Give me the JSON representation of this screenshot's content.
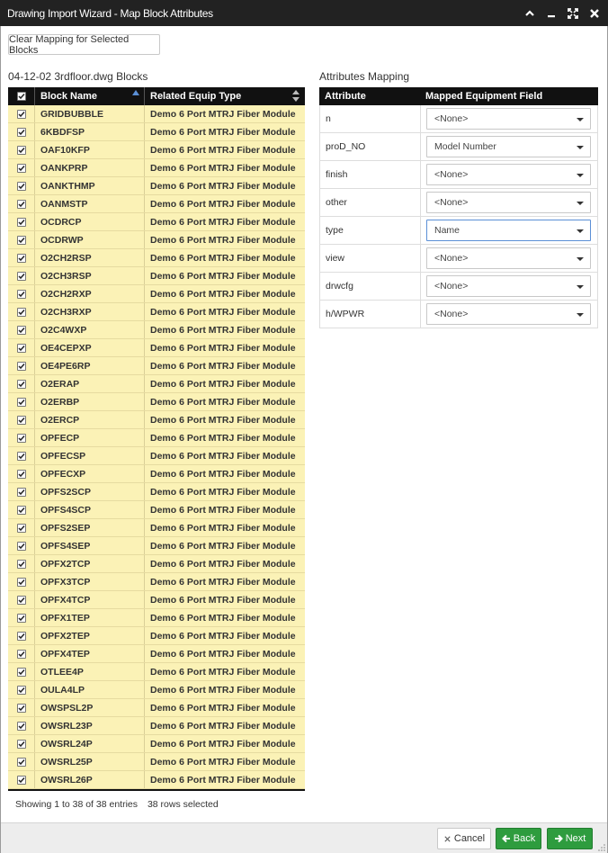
{
  "window": {
    "title": "Drawing Import Wizard - Map Block Attributes"
  },
  "toolbar": {
    "clear_label": "Clear Mapping for Selected Blocks"
  },
  "blocks": {
    "title": "04-12-02 3rdfloor.dwg Blocks",
    "headers": {
      "name": "Block Name",
      "type": "Related Equip Type"
    },
    "rows": [
      {
        "name": "GRIDBUBBLE",
        "type": "Demo 6 Port MTRJ Fiber Module",
        "checked": true
      },
      {
        "name": "6KBDFSP",
        "type": "Demo 6 Port MTRJ Fiber Module",
        "checked": true
      },
      {
        "name": "OAF10KFP",
        "type": "Demo 6 Port MTRJ Fiber Module",
        "checked": true
      },
      {
        "name": "OANKPRP",
        "type": "Demo 6 Port MTRJ Fiber Module",
        "checked": true
      },
      {
        "name": "OANKTHMP",
        "type": "Demo 6 Port MTRJ Fiber Module",
        "checked": true
      },
      {
        "name": "OANMSTP",
        "type": "Demo 6 Port MTRJ Fiber Module",
        "checked": true
      },
      {
        "name": "OCDRCP",
        "type": "Demo 6 Port MTRJ Fiber Module",
        "checked": true
      },
      {
        "name": "OCDRWP",
        "type": "Demo 6 Port MTRJ Fiber Module",
        "checked": true
      },
      {
        "name": "O2CH2RSP",
        "type": "Demo 6 Port MTRJ Fiber Module",
        "checked": true
      },
      {
        "name": "O2CH3RSP",
        "type": "Demo 6 Port MTRJ Fiber Module",
        "checked": true
      },
      {
        "name": "O2CH2RXP",
        "type": "Demo 6 Port MTRJ Fiber Module",
        "checked": true
      },
      {
        "name": "O2CH3RXP",
        "type": "Demo 6 Port MTRJ Fiber Module",
        "checked": true
      },
      {
        "name": "O2C4WXP",
        "type": "Demo 6 Port MTRJ Fiber Module",
        "checked": true
      },
      {
        "name": "OE4CEPXP",
        "type": "Demo 6 Port MTRJ Fiber Module",
        "checked": true
      },
      {
        "name": "OE4PE6RP",
        "type": "Demo 6 Port MTRJ Fiber Module",
        "checked": true
      },
      {
        "name": "O2ERAP",
        "type": "Demo 6 Port MTRJ Fiber Module",
        "checked": true
      },
      {
        "name": "O2ERBP",
        "type": "Demo 6 Port MTRJ Fiber Module",
        "checked": true
      },
      {
        "name": "O2ERCP",
        "type": "Demo 6 Port MTRJ Fiber Module",
        "checked": true
      },
      {
        "name": "OPFECP",
        "type": "Demo 6 Port MTRJ Fiber Module",
        "checked": true
      },
      {
        "name": "OPFECSP",
        "type": "Demo 6 Port MTRJ Fiber Module",
        "checked": true
      },
      {
        "name": "OPFECXP",
        "type": "Demo 6 Port MTRJ Fiber Module",
        "checked": true
      },
      {
        "name": "OPFS2SCP",
        "type": "Demo 6 Port MTRJ Fiber Module",
        "checked": true
      },
      {
        "name": "OPFS4SCP",
        "type": "Demo 6 Port MTRJ Fiber Module",
        "checked": true
      },
      {
        "name": "OPFS2SEP",
        "type": "Demo 6 Port MTRJ Fiber Module",
        "checked": true
      },
      {
        "name": "OPFS4SEP",
        "type": "Demo 6 Port MTRJ Fiber Module",
        "checked": true
      },
      {
        "name": "OPFX2TCP",
        "type": "Demo 6 Port MTRJ Fiber Module",
        "checked": true
      },
      {
        "name": "OPFX3TCP",
        "type": "Demo 6 Port MTRJ Fiber Module",
        "checked": true
      },
      {
        "name": "OPFX4TCP",
        "type": "Demo 6 Port MTRJ Fiber Module",
        "checked": true
      },
      {
        "name": "OPFX1TEP",
        "type": "Demo 6 Port MTRJ Fiber Module",
        "checked": true
      },
      {
        "name": "OPFX2TEP",
        "type": "Demo 6 Port MTRJ Fiber Module",
        "checked": true
      },
      {
        "name": "OPFX4TEP",
        "type": "Demo 6 Port MTRJ Fiber Module",
        "checked": true
      },
      {
        "name": "OTLEE4P",
        "type": "Demo 6 Port MTRJ Fiber Module",
        "checked": true
      },
      {
        "name": "OULA4LP",
        "type": "Demo 6 Port MTRJ Fiber Module",
        "checked": true
      },
      {
        "name": "OWSPSL2P",
        "type": "Demo 6 Port MTRJ Fiber Module",
        "checked": true
      },
      {
        "name": "OWSRL23P",
        "type": "Demo 6 Port MTRJ Fiber Module",
        "checked": true
      },
      {
        "name": "OWSRL24P",
        "type": "Demo 6 Port MTRJ Fiber Module",
        "checked": true
      },
      {
        "name": "OWSRL25P",
        "type": "Demo 6 Port MTRJ Fiber Module",
        "checked": true
      },
      {
        "name": "OWSRL26P",
        "type": "Demo 6 Port MTRJ Fiber Module",
        "checked": true
      }
    ],
    "showing": "Showing 1 to 38 of 38 entries",
    "selected": "38 rows selected",
    "row_color": "#fbf2b6"
  },
  "attributes": {
    "title": "Attributes Mapping",
    "headers": {
      "attribute": "Attribute",
      "field": "Mapped Equipment Field"
    },
    "rows": [
      {
        "name": "n",
        "value": "<None>"
      },
      {
        "name": "proD_NO",
        "value": "Model Number"
      },
      {
        "name": "finish",
        "value": "<None>"
      },
      {
        "name": "other",
        "value": "<None>"
      },
      {
        "name": "type",
        "value": "Name",
        "focused": true
      },
      {
        "name": "view",
        "value": "<None>"
      },
      {
        "name": "drwcfg",
        "value": "<None>"
      },
      {
        "name": "h/WPWR",
        "value": "<None>"
      }
    ]
  },
  "footer": {
    "cancel_label": "Cancel",
    "back_label": "Back",
    "next_label": "Next",
    "accent": "#2e9c3e"
  }
}
